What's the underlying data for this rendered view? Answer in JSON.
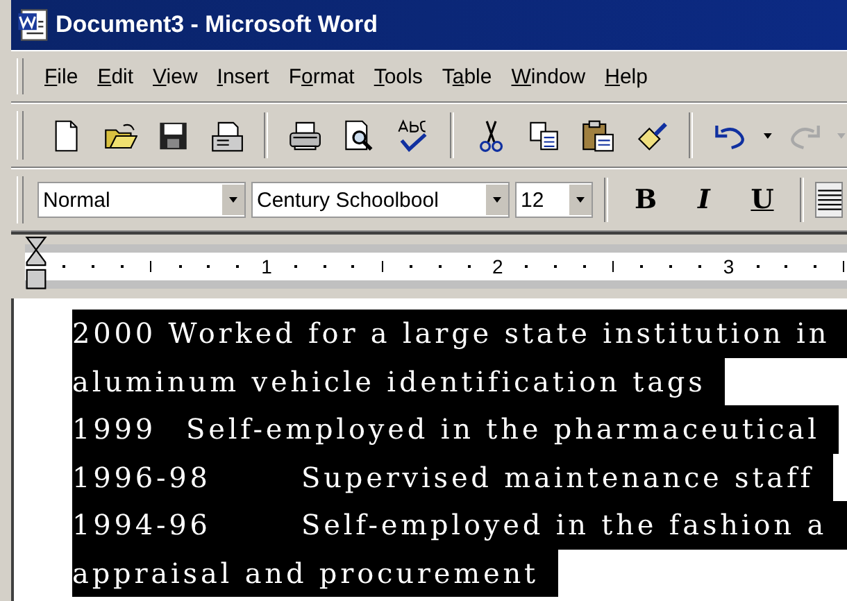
{
  "window": {
    "title": "Document3 - Microsoft Word"
  },
  "menu": [
    {
      "accel": "F",
      "after": "ile"
    },
    {
      "accel": "E",
      "after": "dit"
    },
    {
      "accel": "V",
      "after": "iew"
    },
    {
      "accel": "I",
      "after": "nsert"
    },
    {
      "before": "F",
      "accel": "o",
      "after": "rmat"
    },
    {
      "accel": "T",
      "after": "ools"
    },
    {
      "before": "T",
      "accel": "a",
      "after": "ble"
    },
    {
      "accel": "W",
      "after": "indow"
    },
    {
      "accel": "H",
      "after": "elp"
    }
  ],
  "standard_toolbar": [
    {
      "kind": "new"
    },
    {
      "kind": "open"
    },
    {
      "kind": "save"
    },
    {
      "kind": "mail"
    },
    {
      "kind": "sep"
    },
    {
      "kind": "print"
    },
    {
      "kind": "preview"
    },
    {
      "kind": "spell"
    },
    {
      "kind": "sep"
    },
    {
      "kind": "cut"
    },
    {
      "kind": "copy"
    },
    {
      "kind": "paste"
    },
    {
      "kind": "brush"
    },
    {
      "kind": "sep"
    },
    {
      "kind": "undo",
      "disabled": false
    },
    {
      "kind": "drop",
      "disabled": false
    },
    {
      "kind": "redo",
      "disabled": true
    },
    {
      "kind": "drop",
      "disabled": true
    }
  ],
  "formatting_toolbar": {
    "style": "Normal",
    "font": "Century Schoolbool",
    "size": "12",
    "buttons": [
      {
        "kind": "bold",
        "label": "B"
      },
      {
        "kind": "italic",
        "label": "I"
      },
      {
        "kind": "underline",
        "label": "U"
      }
    ]
  },
  "ruler": {
    "numbers": [
      "1",
      "2",
      "3"
    ]
  },
  "document": {
    "lines": [
      {
        "kind": "plain",
        "text": "2000 Worked for a large state institution in"
      },
      {
        "kind": "plain",
        "text": "aluminum vehicle identification tags"
      },
      {
        "kind": "entry",
        "date": "1999",
        "text": "Self-employed in the pharmaceutical"
      },
      {
        "kind": "tabbed",
        "date": "1996-98",
        "text": "Supervised maintenance staff"
      },
      {
        "kind": "tabbed",
        "date": "1994-96",
        "text": "Self-employed in the fashion a"
      },
      {
        "kind": "plain",
        "text": "appraisal and procurement"
      }
    ]
  }
}
